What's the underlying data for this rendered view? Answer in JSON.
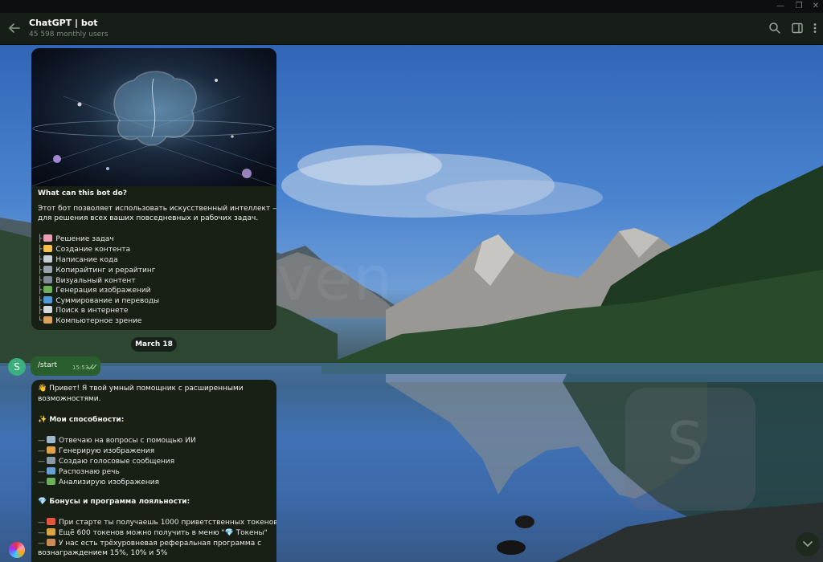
{
  "window": {
    "buttons": [
      "—",
      "❐",
      "✕"
    ]
  },
  "header": {
    "title": "ChatGPT | bot",
    "subtitle": "45 598 monthly users",
    "icons": [
      "back-arrow-icon",
      "search-icon",
      "sidebar-icon",
      "more-icon"
    ]
  },
  "intro": {
    "heading": "What can this bot do?",
    "description_lines": [
      "Этот бот позволяет использовать искусственный интеллект —",
      "для решения всех ваших повседневных и рабочих задач."
    ],
    "features": [
      {
        "tree": "├",
        "emoji": "brain",
        "color": "#e8a0b4",
        "label": "Решение задач"
      },
      {
        "tree": "├",
        "emoji": "writing-hand",
        "color": "#f2c14e",
        "label": "Создание контента"
      },
      {
        "tree": "├",
        "emoji": "laptop",
        "color": "#c9cfd6",
        "label": "Написание кода"
      },
      {
        "tree": "├",
        "emoji": "pen",
        "color": "#9aa3ad",
        "label": "Копирайтинг и рерайтинг"
      },
      {
        "tree": "├",
        "emoji": "camera",
        "color": "#7f8b95",
        "label": "Визуальный контент"
      },
      {
        "tree": "├",
        "emoji": "framed-picture",
        "color": "#6fae5a",
        "label": "Генерация изображений"
      },
      {
        "tree": "├",
        "emoji": "books",
        "color": "#4f9ad6",
        "label": "Суммирование и переводы"
      },
      {
        "tree": "├",
        "emoji": "magnifier",
        "color": "#d5d9dd",
        "label": "Поиск в интернете"
      },
      {
        "tree": "└",
        "emoji": "eye",
        "color": "#d8a45b",
        "label": "Компьютерное зрение"
      }
    ]
  },
  "date_separator": "March 18",
  "avatar_letter": "S",
  "outgoing": {
    "text": "/start",
    "time": "15:53"
  },
  "welcome": {
    "greeting_lines": [
      "👋 Привет! Я твой умный помощник с расширенными",
      "возможностями."
    ],
    "abilities_title": "✨ Мои способности:",
    "abilities": [
      {
        "emoji": "robot",
        "color": "#9fb7c9",
        "label": "Отвечаю на вопросы с помощью ИИ"
      },
      {
        "emoji": "palette",
        "color": "#e0a34a",
        "label": "Генерирую изображения"
      },
      {
        "emoji": "microphone",
        "color": "#8c9aa6",
        "label": "Создаю голосовые сообщения"
      },
      {
        "emoji": "speaker",
        "color": "#6aa0d0",
        "label": "Распознаю речь"
      },
      {
        "emoji": "framed-picture",
        "color": "#6fae5a",
        "label": "Анализирую изображения"
      }
    ],
    "bonus_title": "💎 Бонусы и программа лояльности:",
    "bonuses": [
      {
        "emoji": "gift",
        "color": "#e0563f",
        "label": "При старте ты получаешь 1000 приветственных токенов"
      },
      {
        "emoji": "money-bag",
        "color": "#d9a441",
        "label": "Ещё 600 токенов можно получить в меню \"💎 Токены\""
      },
      {
        "emoji": "people",
        "color": "#c98b5a",
        "label": "У нас есть трёхуровневая реферальная программа с"
      }
    ],
    "bonus_continuation": "вознаграждением 15%, 10% и 5%"
  },
  "colors": {
    "header_bg": "#171e17",
    "bubble_bg": "#182016",
    "outgoing_bg": "#2b5e2e",
    "accent": "#3ab07e"
  }
}
